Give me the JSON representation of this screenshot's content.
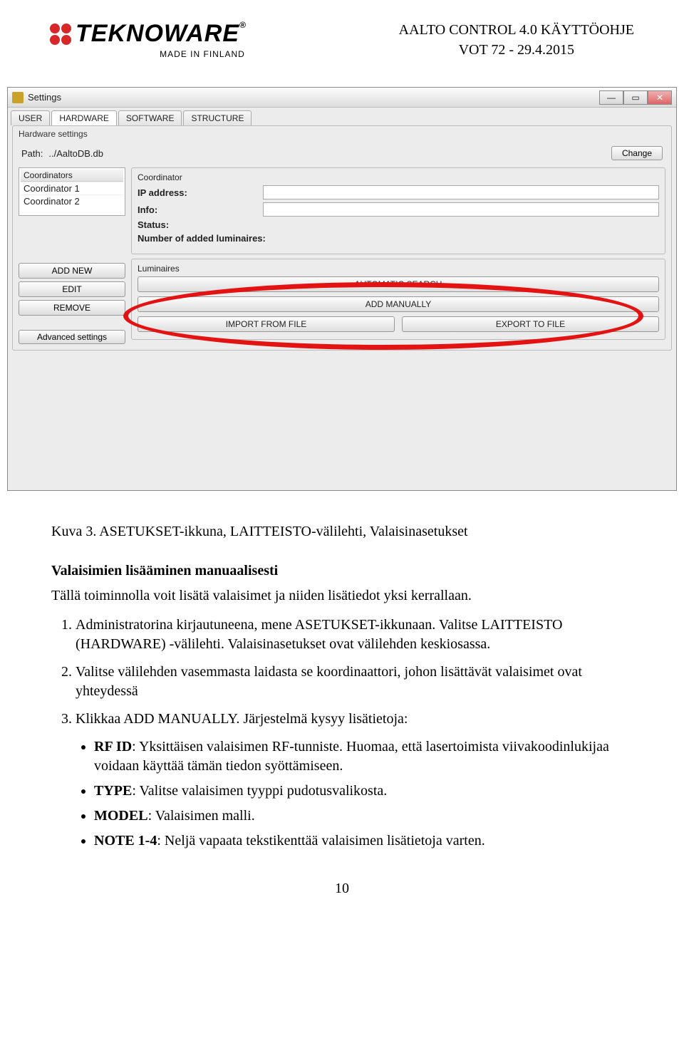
{
  "header": {
    "logo_text": "TEKNOWARE",
    "logo_r": "®",
    "made_in": "MADE IN FINLAND",
    "doc_title_line1": "AALTO CONTROL 4.0 KÄYTTÖOHJE",
    "doc_title_line2": "VOT 72 - 29.4.2015"
  },
  "screenshot": {
    "window_title": "Settings",
    "win_min": "—",
    "win_max": "▭",
    "win_close": "✕",
    "tabs": [
      "USER",
      "HARDWARE",
      "SOFTWARE",
      "STRUCTURE"
    ],
    "active_tab_index": 1,
    "group_title": "Hardware settings",
    "path_label": "Path:",
    "path_value": "../AaltoDB.db",
    "change_btn": "Change",
    "coordinators_header": "Coordinators",
    "coordinators": [
      "Coordinator 1",
      "Coordinator 2"
    ],
    "left_buttons": {
      "add_new": "ADD NEW",
      "edit": "EDIT",
      "remove": "REMOVE",
      "advanced": "Advanced settings"
    },
    "coordinator_box": {
      "legend": "Coordinator",
      "fields": {
        "ip_label": "IP address:",
        "info_label": "Info:",
        "status_label": "Status:",
        "num_label": "Number of added luminaires:"
      }
    },
    "luminaires_box": {
      "legend": "Luminaires",
      "auto_search": "AUTOMATIC SEARCH",
      "add_manually": "ADD MANUALLY",
      "import_file": "IMPORT FROM FILE",
      "export_file": "EXPORT TO FILE"
    }
  },
  "doc": {
    "fig_caption": "Kuva 3. ASETUKSET-ikkuna, LAITTEISTO-välilehti, Valaisinasetukset",
    "subheading": "Valaisimien lisääminen manuaalisesti",
    "intro": "Tällä toiminnolla voit lisätä valaisimet ja niiden lisätiedot yksi kerrallaan.",
    "steps": [
      "Administratorina kirjautuneena, mene ASETUKSET-ikkunaan. Valitse LAITTEISTO (HARDWARE) -välilehti. Valaisinasetukset ovat välilehden keskiosassa.",
      "Valitse välilehden vasemmasta laidasta se koordinaattori, johon lisättävät valaisimet ovat yhteydessä",
      "Klikkaa ADD MANUALLY. Järjestelmä kysyy lisätietoja:"
    ],
    "bullets": [
      {
        "bold": "RF ID",
        "text": ": Yksittäisen valaisimen RF-tunniste. Huomaa, että lasertoimista viivakoodinlukijaa voidaan käyttää tämän tiedon syöttämiseen."
      },
      {
        "bold": "TYPE",
        "text": ": Valitse valaisimen tyyppi pudotusvalikosta."
      },
      {
        "bold": "MODEL",
        "text": ": Valaisimen malli."
      },
      {
        "bold": "NOTE 1-4",
        "text": ": Neljä vapaata tekstikenttää valaisimen lisätietoja varten."
      }
    ],
    "page_number": "10"
  }
}
